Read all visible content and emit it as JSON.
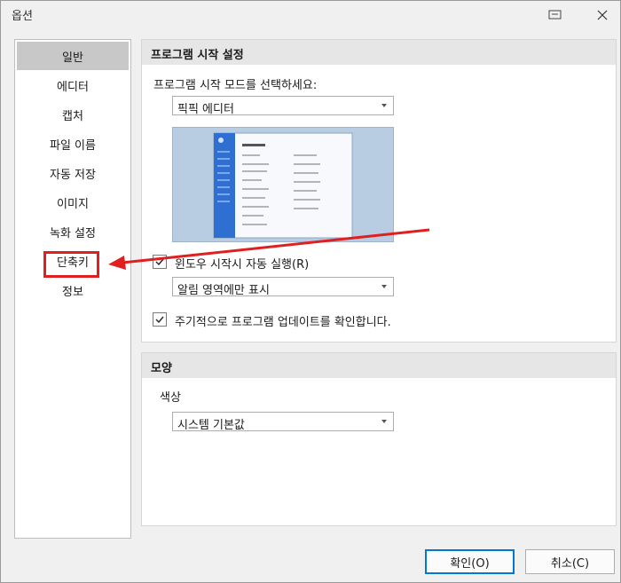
{
  "window": {
    "title": "옵션"
  },
  "sidebar": {
    "items": [
      {
        "label": "일반"
      },
      {
        "label": "에디터"
      },
      {
        "label": "캡처"
      },
      {
        "label": "파일 이름"
      },
      {
        "label": "자동 저장"
      },
      {
        "label": "이미지"
      },
      {
        "label": "녹화 설정"
      },
      {
        "label": "단축키"
      },
      {
        "label": "정보"
      }
    ],
    "selected": "일반"
  },
  "startup": {
    "header": "프로그램 시작 설정",
    "mode_label": "프로그램 시작 모드를 선택하세요:",
    "mode_value": "픽픽 에디터",
    "autostart_label": "윈도우 시작시 자동 실행(R)",
    "autostart_checked": true,
    "tray_value": "알림 영역에만 표시",
    "update_label": "주기적으로 프로그램 업데이트를 확인합니다.",
    "update_checked": true
  },
  "appearance": {
    "header": "모양",
    "color_label": "색상",
    "color_value": "시스템 기본값"
  },
  "buttons": {
    "ok": "확인(O)",
    "cancel": "취소(C)"
  },
  "colors": {
    "highlight": "#e02020",
    "selected": "#c8c8c8",
    "accent": "#0078d4"
  }
}
